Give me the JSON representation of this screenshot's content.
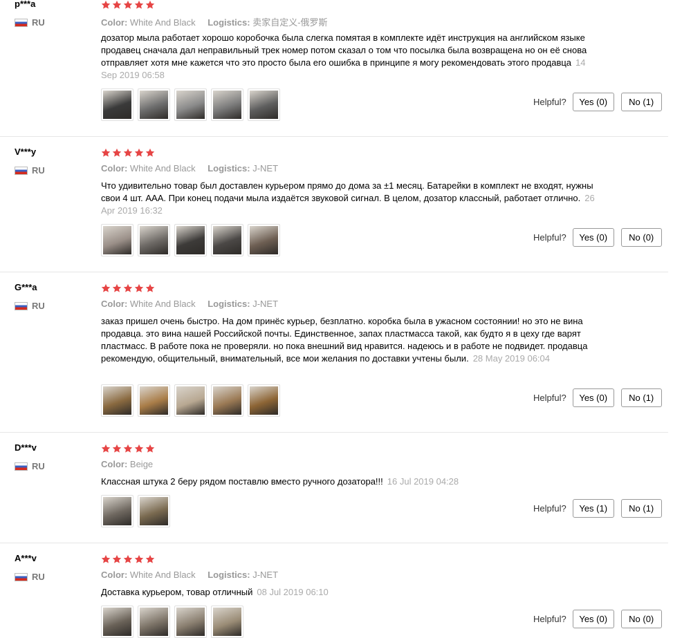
{
  "colors": {
    "star": "#e64545",
    "accent": "#e64545"
  },
  "labels": {
    "color": "Color:",
    "logistics": "Logistics:",
    "helpful": "Helpful?"
  },
  "reviews": [
    {
      "user": "p***a",
      "country": "RU",
      "stars": 5,
      "color_value": "White And Black",
      "logistics_value": "卖家自定义-俄罗斯",
      "text": "дозатор мыла работает хорошо коробочка была слегка помятая в комплекте идёт инструкция на английском языке продавец сначала дал неправильный трек номер потом сказал о том что посылка была возвращена но он её снова отправляет хотя мне кажется что это просто была его ошибка в принципе я могу рекомендовать этого продавца",
      "date": "14 Sep 2019 06:58",
      "yes_label": "Yes (0)",
      "no_label": "No (1)",
      "thumbs": [
        "#3a3a3a",
        "#6d6d6d",
        "#8a8a8a",
        "#7c7c7c",
        "#5e5e5e"
      ]
    },
    {
      "user": "V***y",
      "country": "RU",
      "stars": 5,
      "color_value": "White And Black",
      "logistics_value": "J-NET",
      "text": "Что удивительно товар был доставлен курьером прямо до дома за ±1 месяц. Батарейки в комплект не входят, нужны свои 4 шт. AAA. При конец подачи мыла издаётся звуковой сигнал. В целом, дозатор классный, работает отлично.",
      "date": "26 Apr 2019 16:32",
      "yes_label": "Yes (0)",
      "no_label": "No (0)",
      "thumbs": [
        "#9a8f88",
        "#6e6a66",
        "#3d3b39",
        "#4b4846",
        "#6e5f53"
      ]
    },
    {
      "user": "G***a",
      "country": "RU",
      "stars": 5,
      "color_value": "White And Black",
      "logistics_value": "J-NET",
      "text": "заказ пришел очень быстро. На дом принёс курьер, безплатно. коробка была в ужасном состоянии! но это не вина продавца. это вина нашей Российской почты. Единственное, запах пластмасса такой, как будто я в цеху где варят пластмасс. В работе пока не проверяли. но пока внешний вид нравится. надеюсь и в работе не подвидет. продавца рекомендую, общительный, внимательный, все мои желания по доставки учтены были.",
      "date": "28 May 2019 06:04",
      "yes_label": "Yes (0)",
      "no_label": "No (1)",
      "thumbs": [
        "#8a6a40",
        "#a97d48",
        "#b8a892",
        "#9b7a55",
        "#8d6535"
      ]
    },
    {
      "user": "D***v",
      "country": "RU",
      "stars": 5,
      "color_value": "Beige",
      "logistics_value": "",
      "text": "Классная штука 2 беру рядом поставлю вместо ручного дозатора!!!",
      "date": "16 Jul 2019 04:28",
      "yes_label": "Yes (1)",
      "no_label": "No (1)",
      "thumbs": [
        "#6f6860",
        "#7a6a50"
      ]
    },
    {
      "user": "A***v",
      "country": "RU",
      "stars": 5,
      "color_value": "White And Black",
      "logistics_value": "J-NET",
      "text": "Доставка курьером, товар отличный",
      "date": "08 Jul 2019 06:10",
      "yes_label": "Yes (0)",
      "no_label": "No (0)",
      "thumbs": [
        "#6a6258",
        "#7d7468",
        "#8a7f70",
        "#9a8c76"
      ]
    }
  ]
}
